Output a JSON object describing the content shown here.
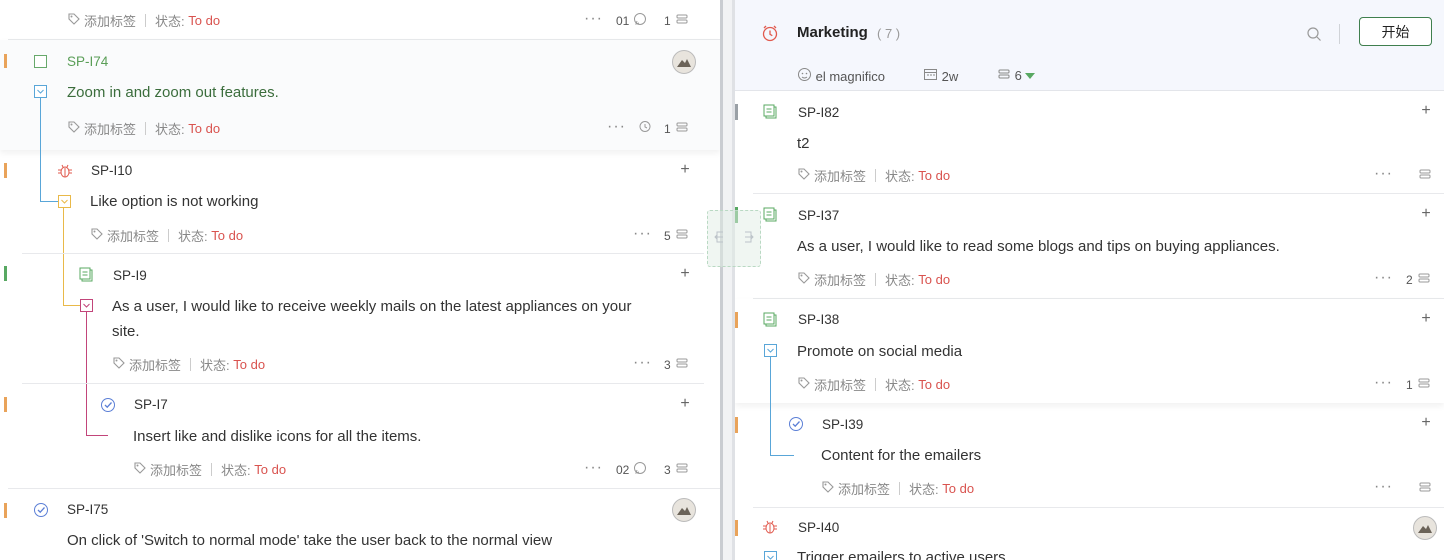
{
  "common": {
    "add_tag": "添加标签",
    "status_label": "状态:",
    "status_value": "To do",
    "more": "···"
  },
  "left": {
    "top_row": {
      "count_left": "01",
      "count_right": "1"
    },
    "items": [
      {
        "id": "SP-I74",
        "title": "Zoom in and zoom out features.",
        "count": "1"
      },
      {
        "id": "SP-I10",
        "title": "Like option is not working",
        "count": "5"
      },
      {
        "id": "SP-I9",
        "title_line1": "As a user, I would like to receive weekly mails on the latest appliances on your",
        "title_line2": "site.",
        "count": "3"
      },
      {
        "id": "SP-I7",
        "title": "Insert like and dislike icons for all the items.",
        "comments": "02",
        "count": "3"
      },
      {
        "id": "SP-I75",
        "title": "On click of 'Switch to normal mode' take the user back to the normal view"
      }
    ]
  },
  "right": {
    "header": {
      "sprint_name": "Marketing",
      "sprint_count": "( 7 )",
      "start_button": "开始",
      "owner": "el magnifico",
      "duration": "2w",
      "items_count": "6"
    },
    "items": [
      {
        "id": "SP-I82",
        "title": "t2",
        "count": ""
      },
      {
        "id": "SP-I37",
        "title": "As a user, I would like to read some blogs and tips on buying appliances.",
        "count": "2"
      },
      {
        "id": "SP-I38",
        "title": "Promote on social media",
        "count": "1"
      },
      {
        "id": "SP-I39",
        "title": "Content for the emailers",
        "count": ""
      },
      {
        "id": "SP-I40",
        "title": "Trigger emailers to active users"
      }
    ]
  },
  "colors": {
    "accent_green": "#3f7f4e",
    "status_red": "#d9534f",
    "bug_red": "#e15a4e",
    "story_green": "#58a862",
    "task_blue": "#5b7fd6"
  }
}
